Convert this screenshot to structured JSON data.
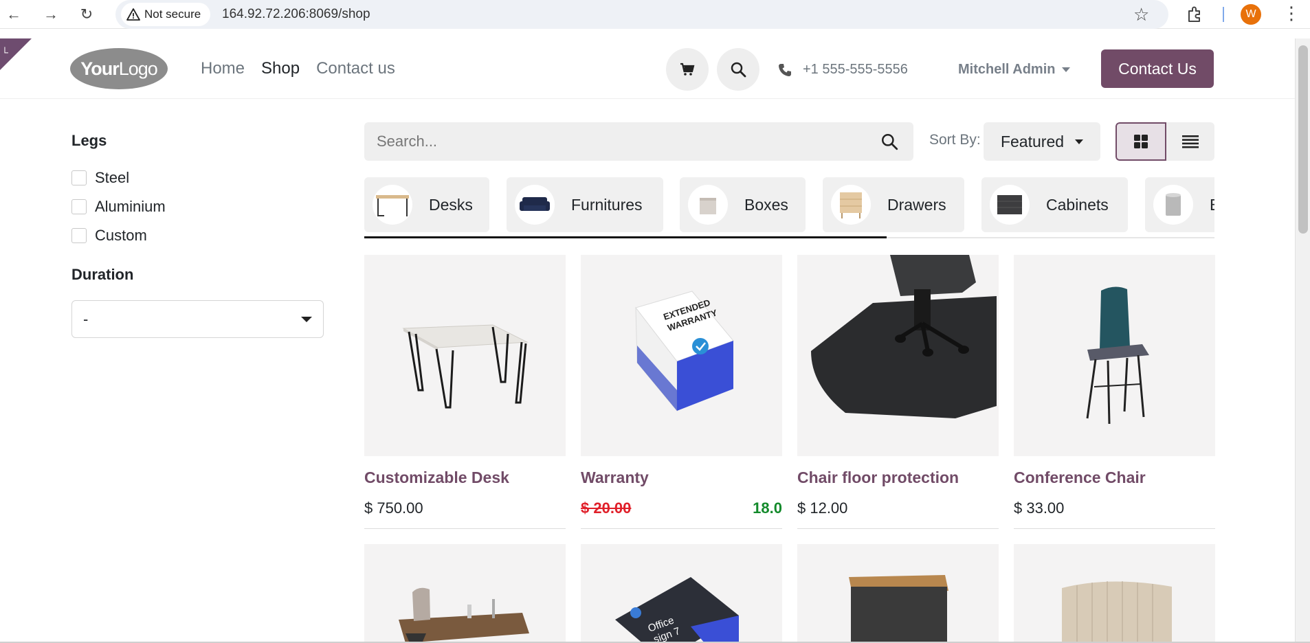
{
  "browser": {
    "security_label": "Not secure",
    "url": "164.92.72.206:8069/shop",
    "profile_initial": "W"
  },
  "header": {
    "logo_bold": "Your",
    "logo_light": "Logo",
    "nav": [
      "Home",
      "Shop",
      "Contact us"
    ],
    "phone": "+1 555-555-5556",
    "user": "Mitchell Admin",
    "cta": "Contact Us",
    "accent_color": "#714b67"
  },
  "sidebar": {
    "legs_title": "Legs",
    "legs_options": [
      "Steel",
      "Aluminium",
      "Custom"
    ],
    "duration_title": "Duration",
    "duration_value": "-"
  },
  "toolbar": {
    "search_placeholder": "Search...",
    "sort_label": "Sort By:",
    "sort_value": "Featured"
  },
  "categories": [
    {
      "label": "Desks",
      "icon": "desk-thumb"
    },
    {
      "label": "Furnitures",
      "icon": "sofa-thumb"
    },
    {
      "label": "Boxes",
      "icon": "box-thumb"
    },
    {
      "label": "Drawers",
      "icon": "drawer-thumb"
    },
    {
      "label": "Cabinets",
      "icon": "cabinet-thumb"
    },
    {
      "label": "B",
      "icon": "bin-thumb"
    }
  ],
  "products": [
    {
      "name": "Customizable Desk",
      "price": "$ 750.00"
    },
    {
      "name": "Warranty",
      "old_price": "$ 20.00",
      "price": "18.0"
    },
    {
      "name": "Chair floor protection",
      "price": "$ 12.00"
    },
    {
      "name": "Conference Chair",
      "price": "$ 33.00"
    }
  ],
  "row2_labels": {
    "office_box": "Office",
    "office_box_line2": "sign 7"
  },
  "colors": {
    "old_price": "#e0202a",
    "discount_price": "#138a2b",
    "product_name": "#714b67"
  }
}
